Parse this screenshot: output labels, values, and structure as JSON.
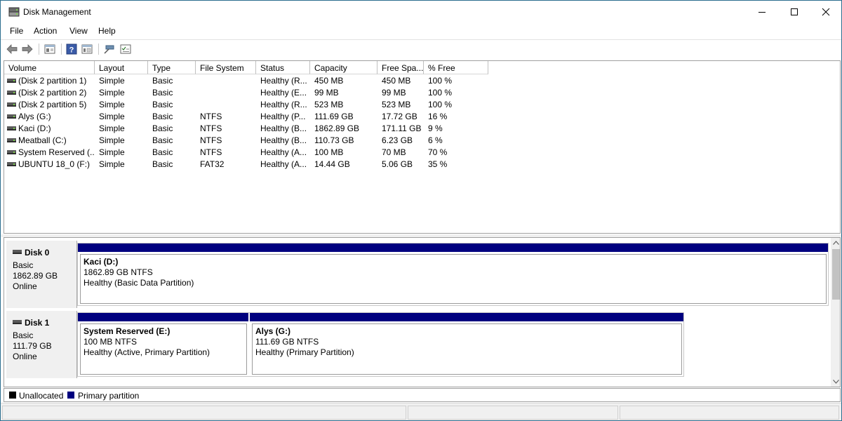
{
  "window": {
    "title": "Disk Management",
    "controls": {
      "minimize": "minimize-icon",
      "maximize": "maximize-icon",
      "close": "close-icon"
    }
  },
  "menu": [
    "File",
    "Action",
    "View",
    "Help"
  ],
  "toolbar": [
    "back-arrow-icon",
    "forward-arrow-icon",
    "show-hide-console-tree-icon",
    "help-icon",
    "properties-icon",
    "connect-icon",
    "checklist-icon"
  ],
  "volume_list": {
    "columns": [
      "Volume",
      "Layout",
      "Type",
      "File System",
      "Status",
      "Capacity",
      "Free Spa...",
      "% Free"
    ],
    "rows": [
      [
        "(Disk 2 partition 1)",
        "Simple",
        "Basic",
        "",
        "Healthy (R...",
        "450 MB",
        "450 MB",
        "100 %"
      ],
      [
        "(Disk 2 partition 2)",
        "Simple",
        "Basic",
        "",
        "Healthy (E...",
        "99 MB",
        "99 MB",
        "100 %"
      ],
      [
        "(Disk 2 partition 5)",
        "Simple",
        "Basic",
        "",
        "Healthy (R...",
        "523 MB",
        "523 MB",
        "100 %"
      ],
      [
        "Alys (G:)",
        "Simple",
        "Basic",
        "NTFS",
        "Healthy (P...",
        "111.69 GB",
        "17.72 GB",
        "16 %"
      ],
      [
        "Kaci (D:)",
        "Simple",
        "Basic",
        "NTFS",
        "Healthy (B...",
        "1862.89 GB",
        "171.11 GB",
        "9 %"
      ],
      [
        "Meatball (C:)",
        "Simple",
        "Basic",
        "NTFS",
        "Healthy (B...",
        "110.73 GB",
        "6.23 GB",
        "6 %"
      ],
      [
        "System Reserved (...",
        "Simple",
        "Basic",
        "NTFS",
        "Healthy (A...",
        "100 MB",
        "70 MB",
        "70 %"
      ],
      [
        "UBUNTU 18_0 (F:)",
        "Simple",
        "Basic",
        "FAT32",
        "Healthy (A...",
        "14.44 GB",
        "5.06 GB",
        "35 %"
      ]
    ]
  },
  "disks": [
    {
      "name": "Disk 0",
      "type": "Basic",
      "size": "1862.89 GB",
      "state": "Online",
      "partitions": [
        {
          "name": "Kaci  (D:)",
          "size_fs": "1862.89 GB NTFS",
          "status": "Healthy (Basic Data Partition)"
        }
      ]
    },
    {
      "name": "Disk 1",
      "type": "Basic",
      "size": "111.79 GB",
      "state": "Online",
      "partitions": [
        {
          "name": "System Reserved  (E:)",
          "size_fs": "100 MB NTFS",
          "status": "Healthy (Active, Primary Partition)"
        },
        {
          "name": "Alys  (G:)",
          "size_fs": "111.69 GB NTFS",
          "status": "Healthy (Primary Partition)"
        }
      ]
    }
  ],
  "legend": [
    {
      "label": "Unallocated",
      "color": "#000000"
    },
    {
      "label": "Primary partition",
      "color": "#00007f"
    }
  ],
  "colors": {
    "primary_partition": "#00007f",
    "unallocated": "#000000",
    "window_border": "#2b6e8f"
  }
}
